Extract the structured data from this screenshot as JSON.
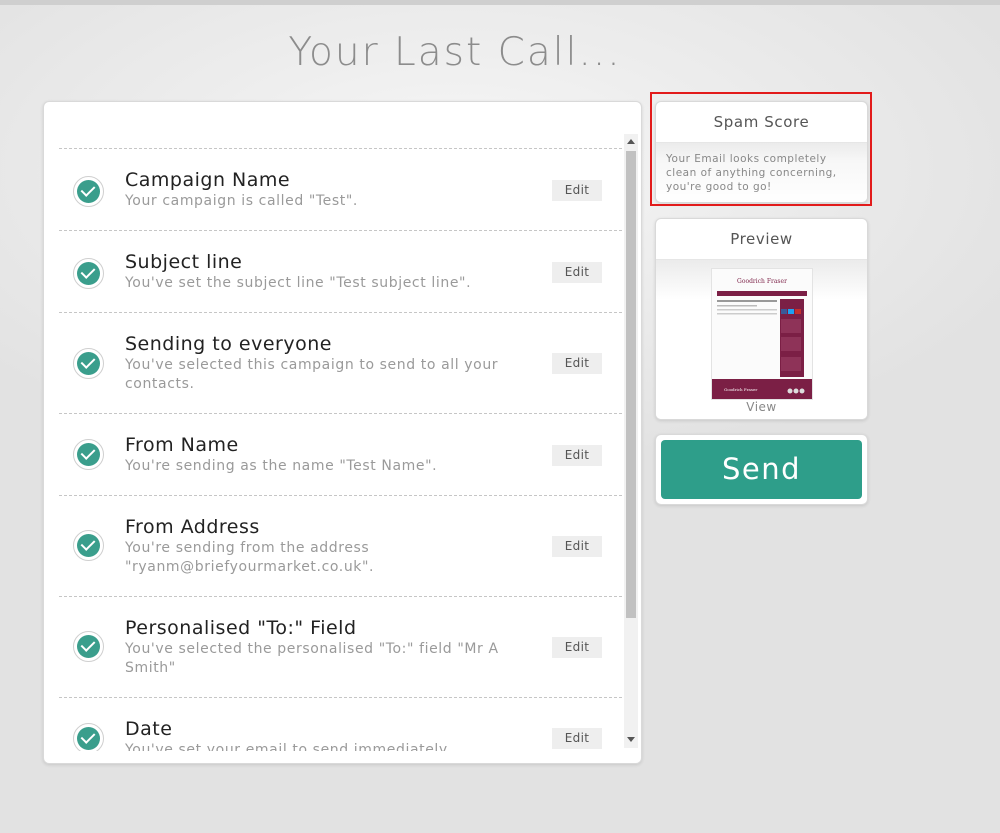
{
  "page": {
    "title": "Your Last Call..."
  },
  "checklist": [
    {
      "title": "Campaign Name",
      "desc": "Your campaign is called \"Test\".",
      "edit": "Edit"
    },
    {
      "title": "Subject line",
      "desc": "You've set the subject line \"Test subject line\".",
      "edit": "Edit"
    },
    {
      "title": "Sending to everyone",
      "desc": "You've selected this campaign to send to all your contacts.",
      "edit": "Edit"
    },
    {
      "title": "From Name",
      "desc": "You're sending as the name \"Test Name\".",
      "edit": "Edit"
    },
    {
      "title": "From Address",
      "desc": "You're sending from the address \"ryanm@briefyourmarket.co.uk\".",
      "edit": "Edit"
    },
    {
      "title": "Personalised \"To:\" Field",
      "desc": "You've selected the personalised \"To:\" field \"Mr A Smith\"",
      "edit": "Edit"
    },
    {
      "title": "Date",
      "desc": "You've set your email to send immediately",
      "edit": "Edit"
    }
  ],
  "spam": {
    "title": "Spam Score",
    "message": "Your Email looks completely clean of anything concerning, you're good to go!"
  },
  "preview": {
    "title": "Preview",
    "view_label": "View",
    "thumb_brand": "Goodrich Fraser",
    "thumb_footer": "Goodrich Fraser"
  },
  "send": {
    "label": "Send"
  },
  "colors": {
    "accent": "#2e9e8a",
    "check": "#3a9e8c",
    "highlight": "#e21b1b",
    "thumb_brand": "#7b1f45"
  }
}
